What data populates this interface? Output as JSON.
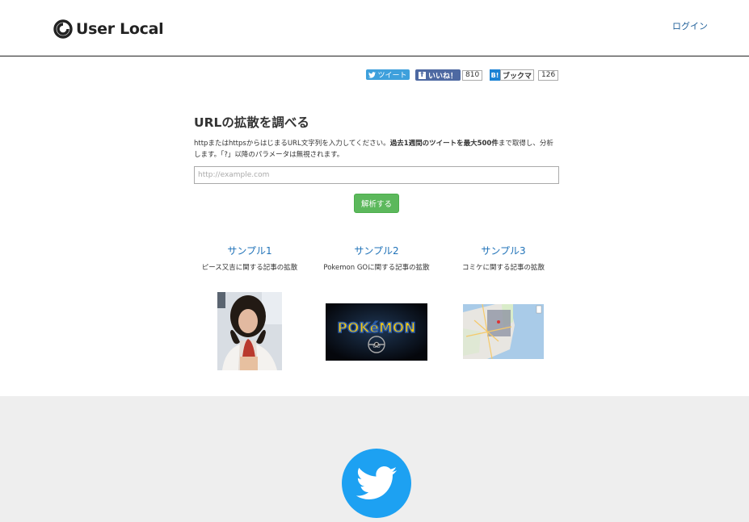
{
  "header": {
    "logo_text": "User Local",
    "login_label": "ログイン"
  },
  "social": {
    "tweet_label": "ツイート",
    "fb_like_label": "いいね！",
    "fb_count": "810",
    "hatena_label": "ブックマ",
    "hatena_count": "126"
  },
  "main": {
    "title": "URLの拡散を調べる",
    "desc_part1": "httpまたはhttpsからはじまるURL文字列を入力してください。",
    "desc_bold": "過去1週間のツイートを最大500件",
    "desc_part2": "まで取得し、分析します。「?」以降のパラメータは無視されます。",
    "input_placeholder": "http://example.com",
    "input_value": "",
    "analyze_button": "解析する"
  },
  "samples": [
    {
      "title": "サンプル1",
      "desc": "ピース又吉に関する記事の拡散"
    },
    {
      "title": "サンプル2",
      "desc": "Pokemon GOに関する記事の拡散"
    },
    {
      "title": "サンプル3",
      "desc": "コミケに関する記事の拡散"
    }
  ],
  "pokemon_logo_text": "POKéMON",
  "pokemon_go_text": "GO",
  "colors": {
    "twitter": "#1da1f2",
    "button_green": "#5cb85c",
    "link_blue": "#1f72b8",
    "facebook": "#4e69a2"
  },
  "icons": [
    "user-local-logo-icon",
    "twitter-bird-icon",
    "facebook-f-icon",
    "hatena-b-icon"
  ]
}
